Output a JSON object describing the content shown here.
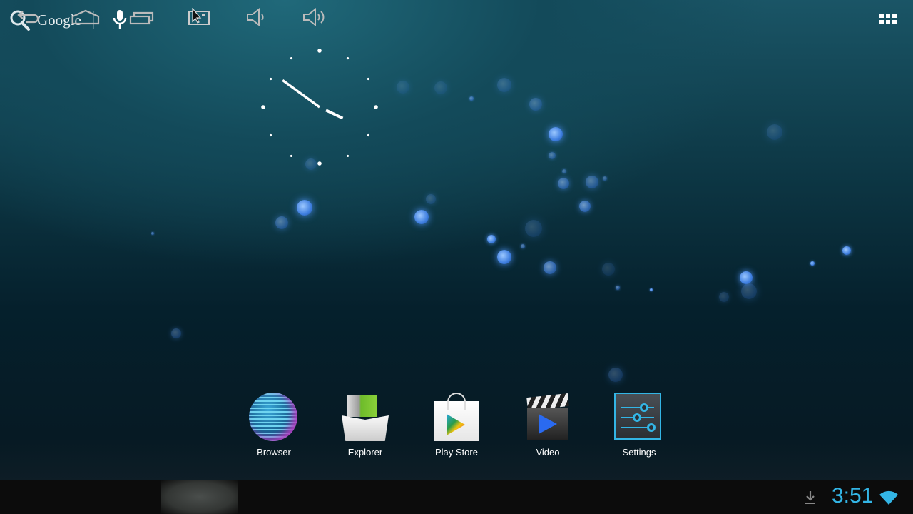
{
  "search": {
    "label": "Google",
    "icons": [
      "search-icon",
      "microphone-icon"
    ]
  },
  "clock": {
    "hour": 3,
    "minute": 51
  },
  "dock": {
    "apps": [
      {
        "label": "Browser",
        "icon": "globe-icon"
      },
      {
        "label": "Explorer",
        "icon": "box-icon"
      },
      {
        "label": "Play Store",
        "icon": "play-store-icon"
      },
      {
        "label": "Video",
        "icon": "clapperboard-icon"
      },
      {
        "label": "Settings",
        "icon": "sliders-icon"
      }
    ]
  },
  "navbar": {
    "buttons": [
      "back",
      "home",
      "recent-apps",
      "screenshot",
      "volume-down",
      "volume-up"
    ]
  },
  "status": {
    "time": "3:51",
    "accent": "#33b5e5"
  }
}
